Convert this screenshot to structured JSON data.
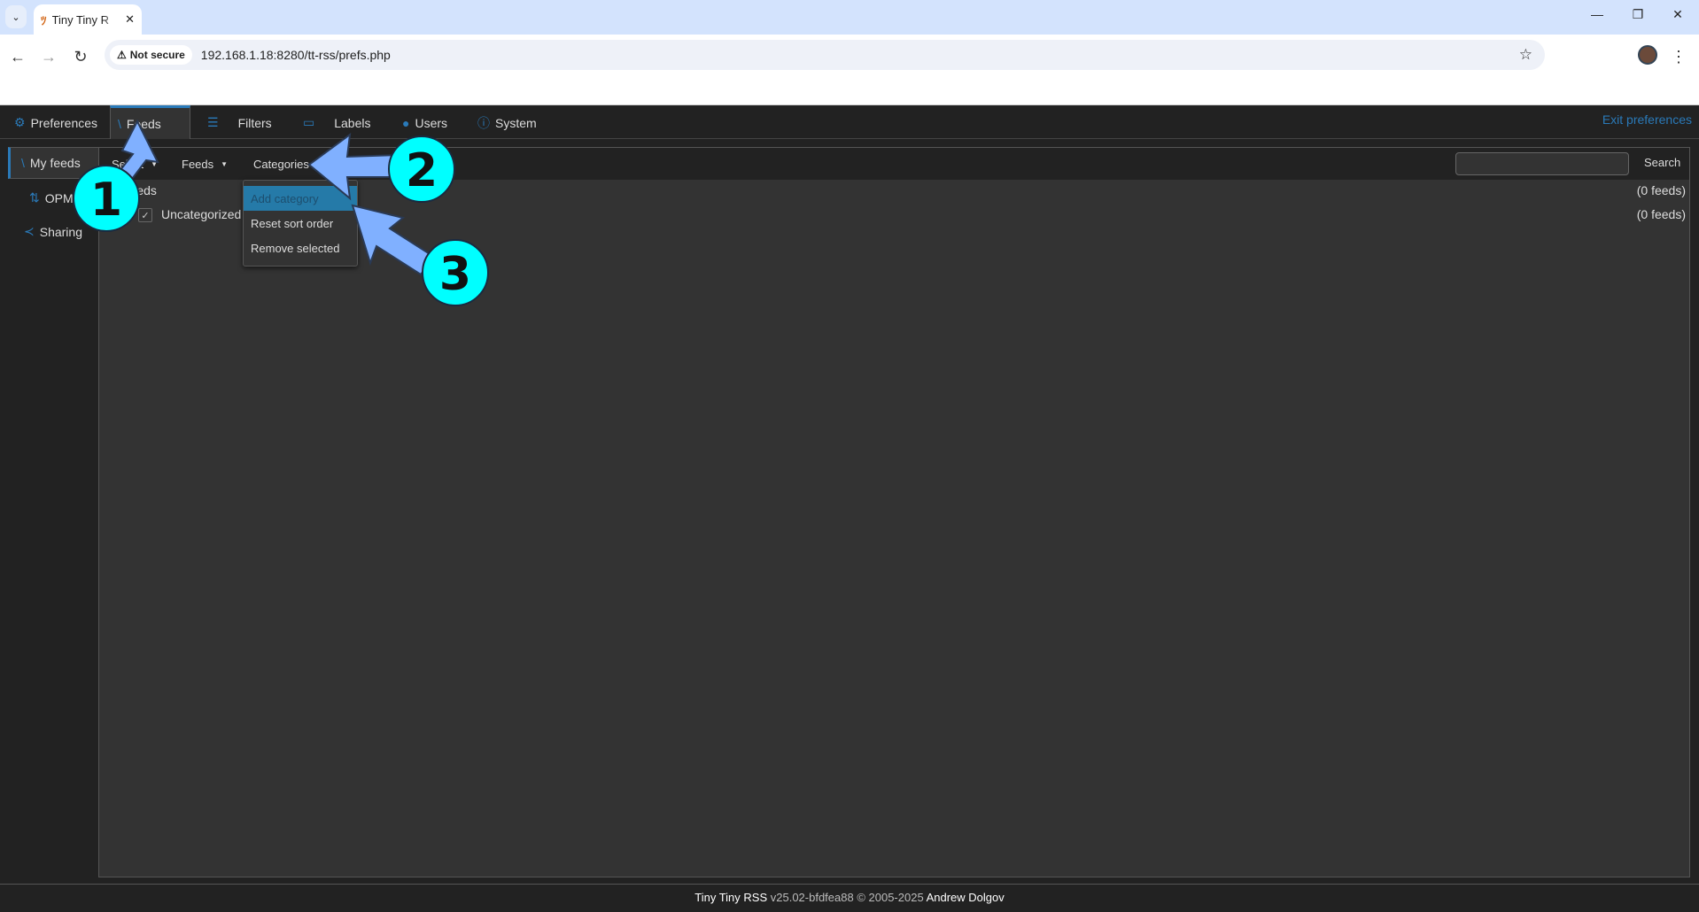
{
  "browser": {
    "tab_title": "Tiny Tiny R",
    "security": "Not secure",
    "url": "192.168.1.18:8280/tt-rss/prefs.php"
  },
  "app_tabs": [
    {
      "label": "Preferences",
      "icon": "gear-icon"
    },
    {
      "label": "Feeds",
      "icon": "rss-icon",
      "active": true
    },
    {
      "label": "Filters",
      "icon": "filter-icon"
    },
    {
      "label": "Labels",
      "icon": "label-icon"
    },
    {
      "label": "Users",
      "icon": "user-icon"
    },
    {
      "label": "System",
      "icon": "info-icon"
    }
  ],
  "exit_prefs": "Exit preferences",
  "sidebar": [
    {
      "label": "My feeds",
      "icon": "rss-icon",
      "active": true
    },
    {
      "label": "OPML",
      "icon": "sort-arrows-icon"
    },
    {
      "label": "Sharing",
      "icon": "share-icon"
    }
  ],
  "toolbar": {
    "select": "Select",
    "feeds": "Feeds",
    "categories": "Categories",
    "search_value": "",
    "search_button": "Search"
  },
  "tree": [
    {
      "label": "Feeds",
      "count": "(0 feeds)"
    },
    {
      "label": "Uncategorized",
      "count": "(0 feeds)",
      "checked": true
    }
  ],
  "menu": [
    "Add category",
    "Reset sort order",
    "Remove selected"
  ],
  "footer": {
    "app": "Tiny Tiny RSS",
    "version": "v25.02-bfdfea88 © 2005-2025",
    "author": "Andrew Dolgov"
  },
  "annotations": [
    "1",
    "2",
    "3"
  ],
  "colors": {
    "accent": "#2a7ab9",
    "annotation_circle": "#00ffff",
    "annotation_arrow": "#80b0ff"
  }
}
